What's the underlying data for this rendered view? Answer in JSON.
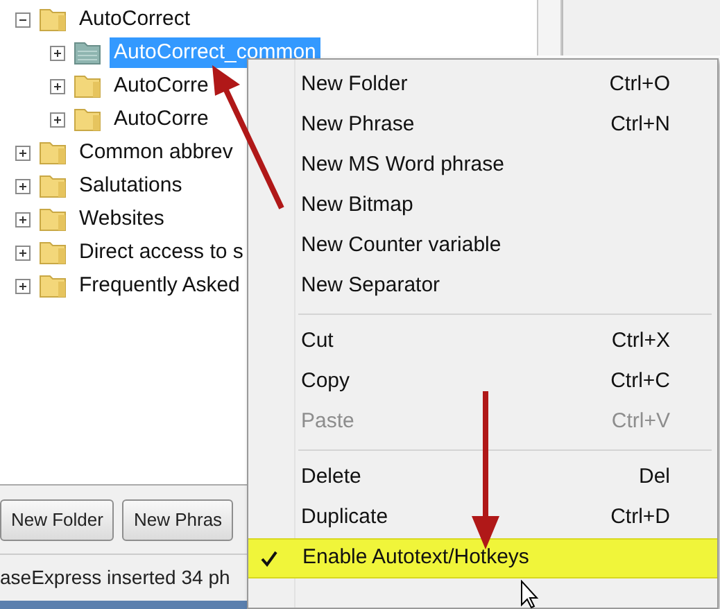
{
  "tree": [
    {
      "label": "AutoCorrect",
      "kind": "folder",
      "expanded": true,
      "selected": false,
      "children": [
        {
          "label": "AutoCorrect_common",
          "kind": "phrase_folder",
          "expanded": false,
          "selected": true
        },
        {
          "label": "AutoCorre",
          "kind": "folder",
          "expanded": false,
          "selected": false
        },
        {
          "label": "AutoCorre",
          "kind": "folder",
          "expanded": false,
          "selected": false
        }
      ]
    },
    {
      "label": "Common abbrev",
      "kind": "folder",
      "expanded": false,
      "selected": false
    },
    {
      "label": "Salutations",
      "kind": "folder",
      "expanded": false,
      "selected": false
    },
    {
      "label": "Websites",
      "kind": "folder",
      "expanded": false,
      "selected": false
    },
    {
      "label": "Direct access to s",
      "kind": "folder",
      "expanded": false,
      "selected": false
    },
    {
      "label": "Frequently Asked",
      "kind": "folder",
      "expanded": false,
      "selected": false
    }
  ],
  "buttons": [
    "New Folder",
    "New Phras"
  ],
  "status_bar": "aseExpress inserted 34 ph",
  "context_menu": [
    {
      "kind": "item",
      "label": "New Folder",
      "shortcut": "Ctrl+O",
      "disabled": false,
      "checked": false,
      "highlighted": false
    },
    {
      "kind": "item",
      "label": "New Phrase",
      "shortcut": "Ctrl+N",
      "disabled": false,
      "checked": false,
      "highlighted": false
    },
    {
      "kind": "item",
      "label": "New MS Word phrase",
      "disabled": false,
      "checked": false,
      "highlighted": false
    },
    {
      "kind": "item",
      "label": "New Bitmap",
      "disabled": false,
      "checked": false,
      "highlighted": false
    },
    {
      "kind": "item",
      "label": "New Counter variable",
      "disabled": false,
      "checked": false,
      "highlighted": false
    },
    {
      "kind": "item",
      "label": "New Separator",
      "disabled": false,
      "checked": false,
      "highlighted": false
    },
    {
      "kind": "separator"
    },
    {
      "kind": "item",
      "label": "Cut",
      "shortcut": "Ctrl+X",
      "disabled": false,
      "checked": false,
      "highlighted": false
    },
    {
      "kind": "item",
      "label": "Copy",
      "shortcut": "Ctrl+C",
      "disabled": false,
      "checked": false,
      "highlighted": false
    },
    {
      "kind": "item",
      "label": "Paste",
      "shortcut": "Ctrl+V",
      "disabled": true,
      "checked": false,
      "highlighted": false
    },
    {
      "kind": "separator"
    },
    {
      "kind": "item",
      "label": "Delete",
      "shortcut": "Del",
      "disabled": false,
      "checked": false,
      "highlighted": false
    },
    {
      "kind": "item",
      "label": "Duplicate",
      "shortcut": "Ctrl+D",
      "disabled": false,
      "checked": false,
      "highlighted": false
    },
    {
      "kind": "item",
      "label": "Enable Autotext/Hotkeys",
      "disabled": false,
      "checked": true,
      "highlighted": true
    }
  ]
}
